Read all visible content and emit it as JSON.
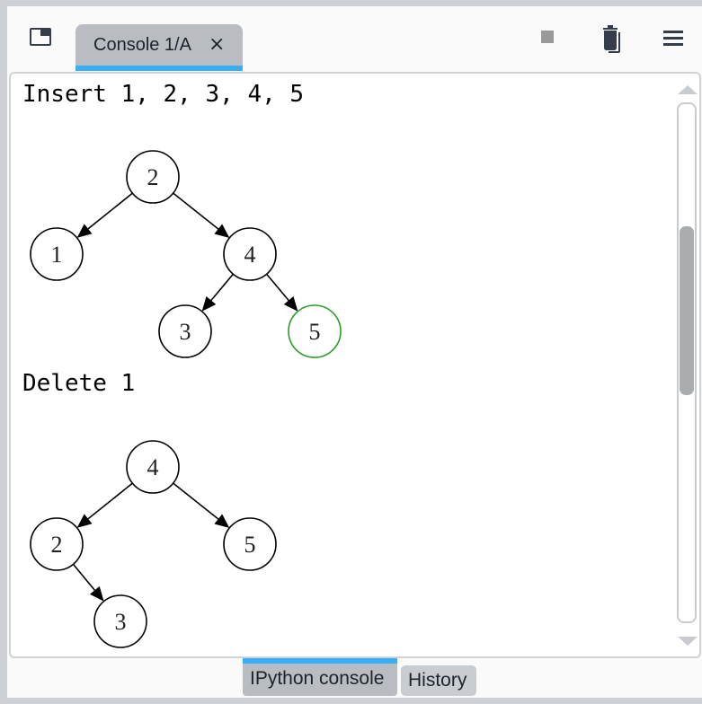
{
  "toolbar": {
    "undock_icon": "undock-icon",
    "tab": {
      "label": "Console 1/A",
      "close_glyph": "×"
    },
    "stop_icon": "stop-icon",
    "clear_icon": "trash-icon",
    "menu_icon": "hamburger-menu-icon"
  },
  "console": {
    "outputs": [
      {
        "text": "Insert 1, 2, 3, 4, 5",
        "tree": {
          "nodes": [
            {
              "id": "n2",
              "label": "2",
              "color": "#000000"
            },
            {
              "id": "n1",
              "label": "1",
              "color": "#000000"
            },
            {
              "id": "n4",
              "label": "4",
              "color": "#000000"
            },
            {
              "id": "n3",
              "label": "3",
              "color": "#000000"
            },
            {
              "id": "n5",
              "label": "5",
              "color": "#2a9d2a"
            }
          ],
          "edges": [
            [
              "n2",
              "n1"
            ],
            [
              "n2",
              "n4"
            ],
            [
              "n4",
              "n3"
            ],
            [
              "n4",
              "n5"
            ]
          ]
        }
      },
      {
        "text": "Delete 1",
        "tree": {
          "nodes": [
            {
              "id": "n4",
              "label": "4",
              "color": "#000000"
            },
            {
              "id": "n2",
              "label": "2",
              "color": "#000000"
            },
            {
              "id": "n5",
              "label": "5",
              "color": "#000000"
            },
            {
              "id": "n3",
              "label": "3",
              "color": "#000000"
            }
          ],
          "edges": [
            [
              "n4",
              "n2"
            ],
            [
              "n4",
              "n5"
            ],
            [
              "n2",
              "n3"
            ]
          ]
        }
      }
    ]
  },
  "scrollbar": {
    "position_fraction": 0.35
  },
  "bottom_tabs": [
    {
      "label": "IPython console",
      "active": true
    },
    {
      "label": "History",
      "active": false
    }
  ],
  "colors": {
    "accent": "#37aef5",
    "highlight_node": "#2a9d2a"
  }
}
